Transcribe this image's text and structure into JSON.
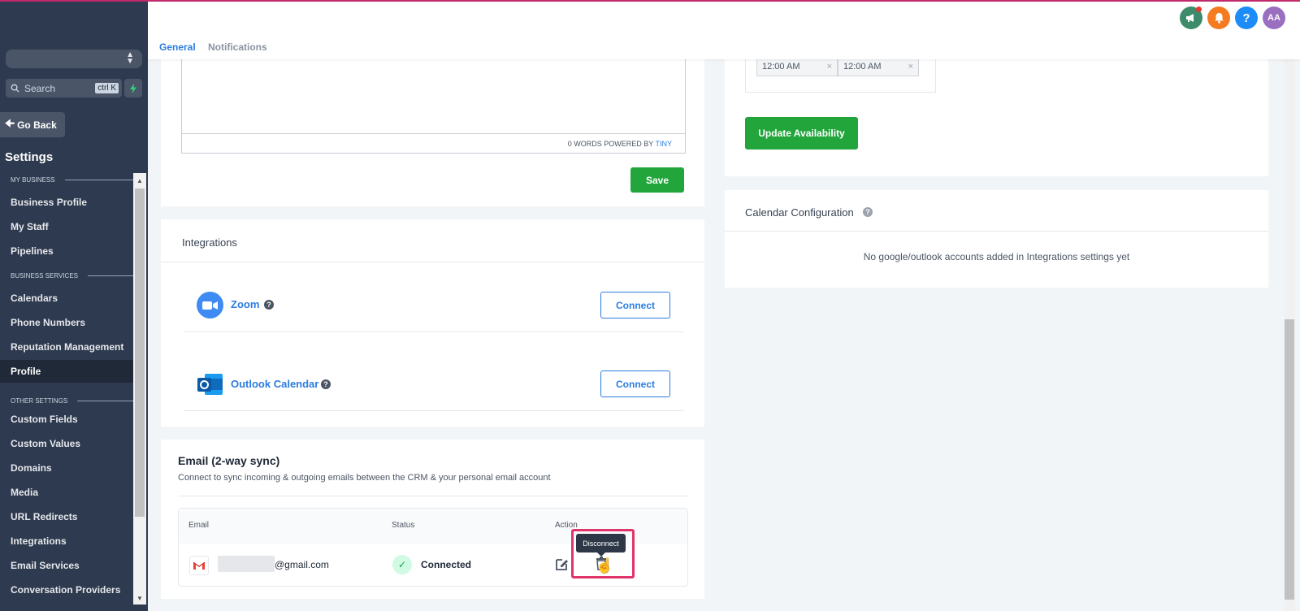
{
  "sidebar": {
    "search_placeholder": "Search",
    "search_shortcut": "ctrl K",
    "go_back": "Go Back",
    "settings_title": "Settings",
    "sections": [
      {
        "label": "MY BUSINESS"
      },
      {
        "label": "BUSINESS SERVICES"
      },
      {
        "label": "OTHER SETTINGS"
      }
    ],
    "items": [
      {
        "label": "Business Profile"
      },
      {
        "label": "My Staff"
      },
      {
        "label": "Pipelines"
      },
      {
        "label": "Calendars"
      },
      {
        "label": "Phone Numbers"
      },
      {
        "label": "Reputation Management"
      },
      {
        "label": "Profile",
        "active": true
      },
      {
        "label": "Custom Fields"
      },
      {
        "label": "Custom Values"
      },
      {
        "label": "Domains"
      },
      {
        "label": "Media"
      },
      {
        "label": "URL Redirects"
      },
      {
        "label": "Integrations"
      },
      {
        "label": "Email Services"
      },
      {
        "label": "Conversation Providers"
      }
    ]
  },
  "header": {
    "tabs": [
      {
        "label": "General",
        "active": true
      },
      {
        "label": "Notifications"
      }
    ],
    "icons": [
      {
        "name": "megaphone-icon",
        "color": "#3d8b6b"
      },
      {
        "name": "bell-icon",
        "color": "#f47b20"
      },
      {
        "name": "help-icon",
        "color": "#1d8cf8"
      }
    ],
    "avatar": {
      "initials": "AA",
      "color": "#9b6fc0"
    }
  },
  "editor": {
    "word_count": "0 WORDS POWERED BY",
    "brand": "TINY",
    "save_label": "Save"
  },
  "availability": {
    "time_from": "12:00 AM",
    "time_to": "12:00 AM",
    "update_label": "Update Availability"
  },
  "calendar_config": {
    "title": "Calendar Configuration",
    "empty_message": "No google/outlook accounts added in Integrations settings yet"
  },
  "integrations": {
    "title": "Integrations",
    "items": [
      {
        "name": "Zoom",
        "connect_label": "Connect"
      },
      {
        "name": "Outlook Calendar",
        "connect_label": "Connect"
      }
    ]
  },
  "email_sync": {
    "title": "Email (2-way sync)",
    "subtitle": "Connect to sync incoming & outgoing emails between the CRM & your personal email account",
    "columns": [
      "Email",
      "Status",
      "Action"
    ],
    "rows": [
      {
        "email": "@gmail.com",
        "status": "Connected"
      }
    ],
    "tooltip": "Disconnect"
  },
  "colors": {
    "sidebar_bg": "#2e3a4f",
    "accent_blue": "#2b7de0",
    "success_green": "#22a63c",
    "highlight": "#e0356a"
  }
}
